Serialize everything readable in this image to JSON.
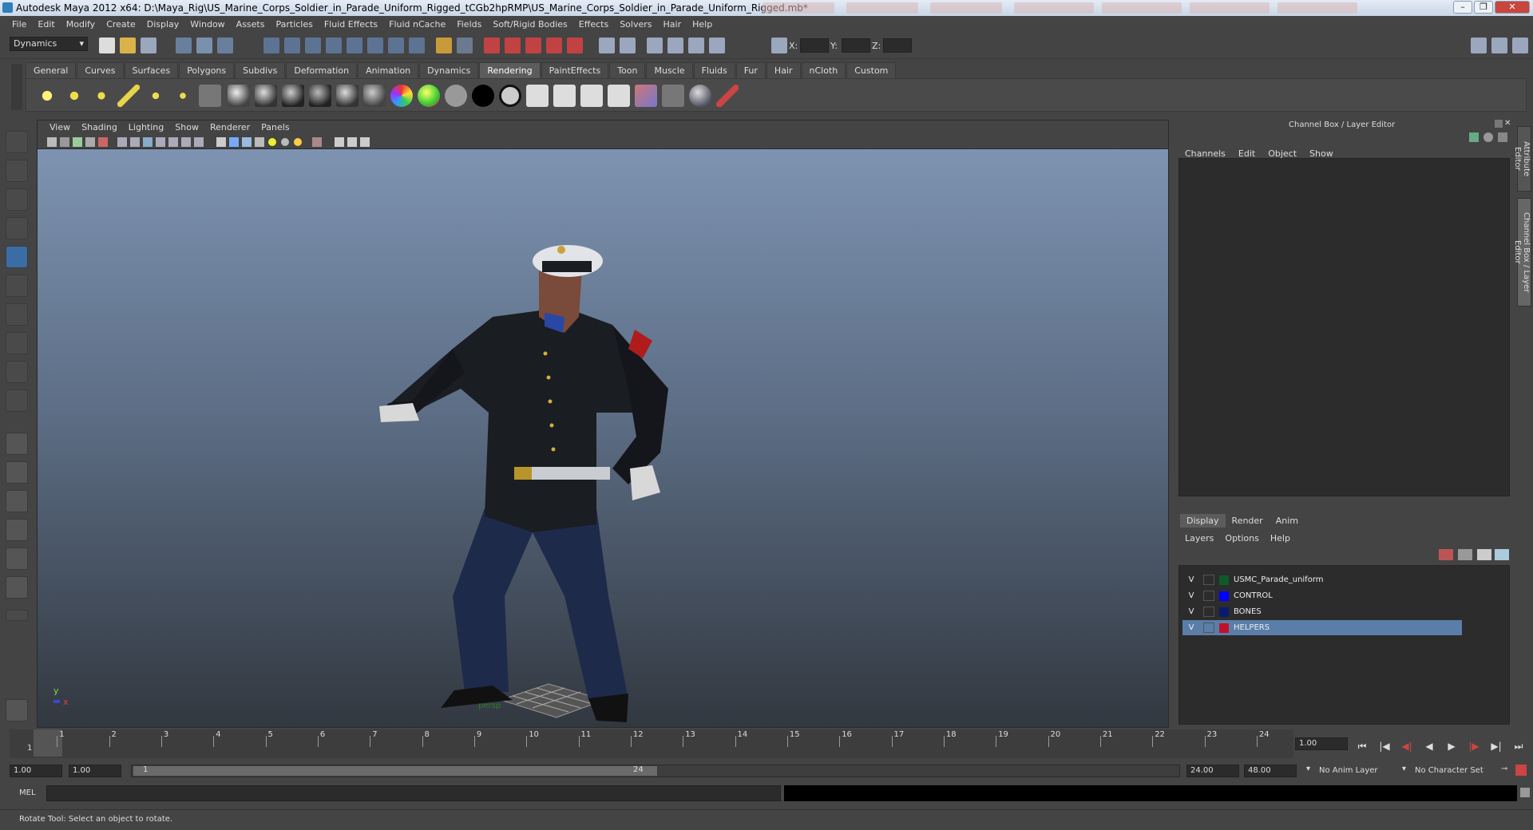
{
  "window": {
    "title": "Autodesk Maya 2012 x64: D:\\Maya_Rig\\US_Marine_Corps_Soldier_in_Parade_Uniform_Rigged_tCGb2hpRMP\\US_Marine_Corps_Soldier_in_Parade_Uniform_Rigged.mb*"
  },
  "menu": [
    "File",
    "Edit",
    "Modify",
    "Create",
    "Display",
    "Window",
    "Assets",
    "Particles",
    "Fluid Effects",
    "Fluid nCache",
    "Fields",
    "Soft/Rigid Bodies",
    "Effects",
    "Solvers",
    "Hair",
    "Help"
  ],
  "status": {
    "mode": "Dynamics",
    "x_label": "X:",
    "y_label": "Y:",
    "z_label": "Z:"
  },
  "shelf_tabs": [
    "General",
    "Curves",
    "Surfaces",
    "Polygons",
    "Subdivs",
    "Deformation",
    "Animation",
    "Dynamics",
    "Rendering",
    "PaintEffects",
    "Toon",
    "Muscle",
    "Fluids",
    "Fur",
    "Hair",
    "nCloth",
    "Custom"
  ],
  "shelf_active": "Rendering",
  "viewport": {
    "menu": [
      "View",
      "Shading",
      "Lighting",
      "Show",
      "Renderer",
      "Panels"
    ],
    "camera": "persp",
    "axis_y": "y",
    "axis_x": "x"
  },
  "panel": {
    "title": "Channel Box / Layer Editor",
    "channel_menu": [
      "Channels",
      "Edit",
      "Object",
      "Show"
    ],
    "layer_tabs": [
      "Display",
      "Render",
      "Anim"
    ],
    "layer_menu": [
      "Layers",
      "Options",
      "Help"
    ],
    "layers": [
      {
        "v": "V",
        "name": "USMC_Parade_uniform",
        "color": "#0f5a2a"
      },
      {
        "v": "V",
        "name": "CONTROL",
        "color": "#0000ff"
      },
      {
        "v": "V",
        "name": "BONES",
        "color": "#0a1a6e"
      },
      {
        "v": "V",
        "name": "HELPERS",
        "color": "#c0102a"
      }
    ],
    "side_tabs": [
      "Attribute Editor",
      "Channel Box / Layer Editor"
    ]
  },
  "timeline": {
    "ticks": [
      "1",
      "2",
      "3",
      "4",
      "5",
      "6",
      "7",
      "8",
      "9",
      "10",
      "11",
      "12",
      "13",
      "14",
      "15",
      "16",
      "17",
      "18",
      "19",
      "20",
      "21",
      "22",
      "23",
      "24"
    ],
    "current_frame": "1",
    "current_time": "1.00"
  },
  "range": {
    "start_time": "1.00",
    "playback_start": "1.00",
    "slider_start": "1",
    "slider_end": "24",
    "playback_end": "24.00",
    "end_time": "48.00",
    "anim_layer": "No Anim Layer",
    "char_set": "No Character Set"
  },
  "cmd": {
    "label": "MEL"
  },
  "help": {
    "text": "Rotate Tool: Select an object to rotate."
  }
}
